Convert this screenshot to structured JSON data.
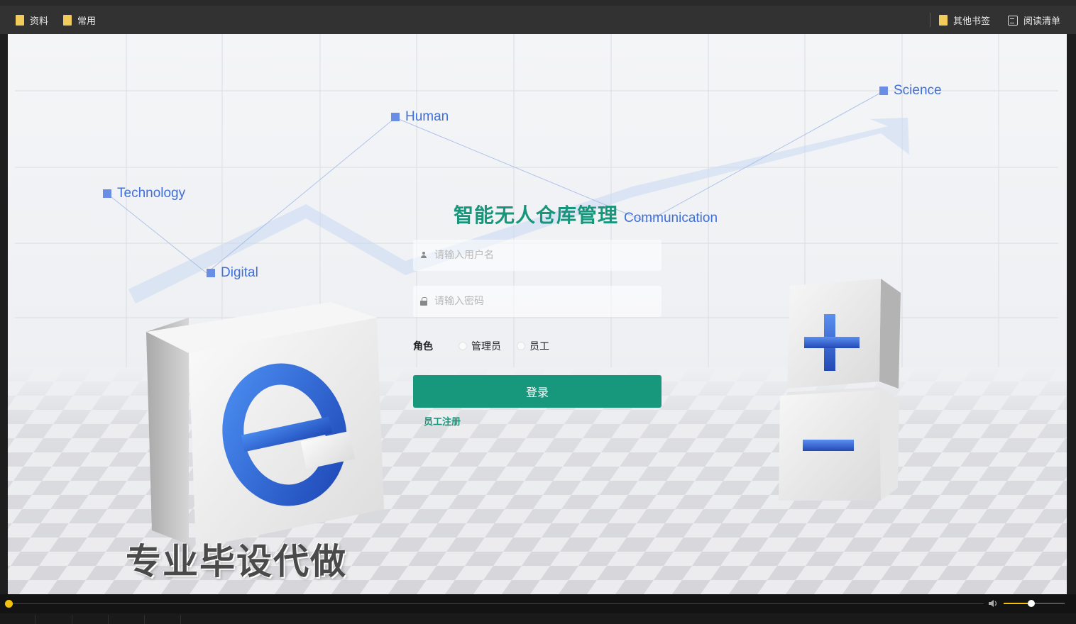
{
  "bookmarks": {
    "left": [
      {
        "label": "资料"
      },
      {
        "label": "常用"
      }
    ],
    "other_label": "其他书签",
    "reading_label": "阅读清单"
  },
  "background": {
    "labels": [
      "Technology",
      "Human",
      "Digital",
      "Science"
    ],
    "cube_plus": "+",
    "cube_minus": "−",
    "cube_e": "e"
  },
  "title": {
    "cn": "智能无人仓库管理",
    "en": "Communication"
  },
  "form": {
    "username_placeholder": "请输入用户名",
    "password_placeholder": "请输入密码",
    "role_label": "角色",
    "roles": [
      "管理员",
      "员工"
    ],
    "login_label": "登录",
    "register_label": "员工注册"
  },
  "overlay": {
    "text": "专业毕设代做"
  },
  "media": {
    "progress": 0.0,
    "volume": 0.45
  },
  "colors": {
    "accent": "#17977b",
    "tech_blue": "#3f6fd8"
  }
}
